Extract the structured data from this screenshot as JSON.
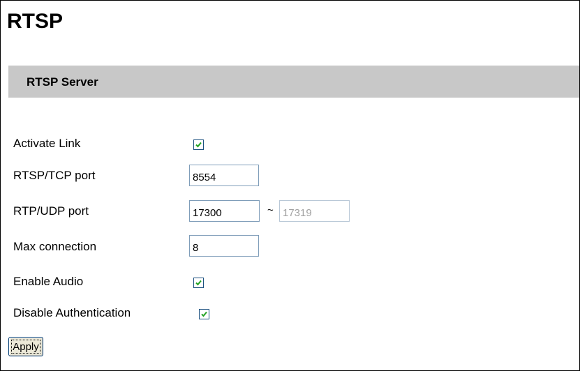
{
  "page": {
    "title": "RTSP"
  },
  "section": {
    "label": "RTSP Server"
  },
  "fields": {
    "activate_link": {
      "label": "Activate Link",
      "checked": true
    },
    "rtsp_tcp_port": {
      "label": "RTSP/TCP port",
      "value": "8554"
    },
    "rtp_udp_port": {
      "label": "RTP/UDP port",
      "value_start": "17300",
      "separator": "~",
      "value_end": "17319"
    },
    "max_connection": {
      "label": "Max connection",
      "value": "8"
    },
    "enable_audio": {
      "label": "Enable Audio",
      "checked": true
    },
    "disable_authentication": {
      "label": "Disable Authentication",
      "checked": true
    }
  },
  "actions": {
    "apply_label": "Apply"
  },
  "colors": {
    "section_bg": "#c8c8c8",
    "checkmark": "#21a121",
    "input_border": "#7f9db9"
  }
}
